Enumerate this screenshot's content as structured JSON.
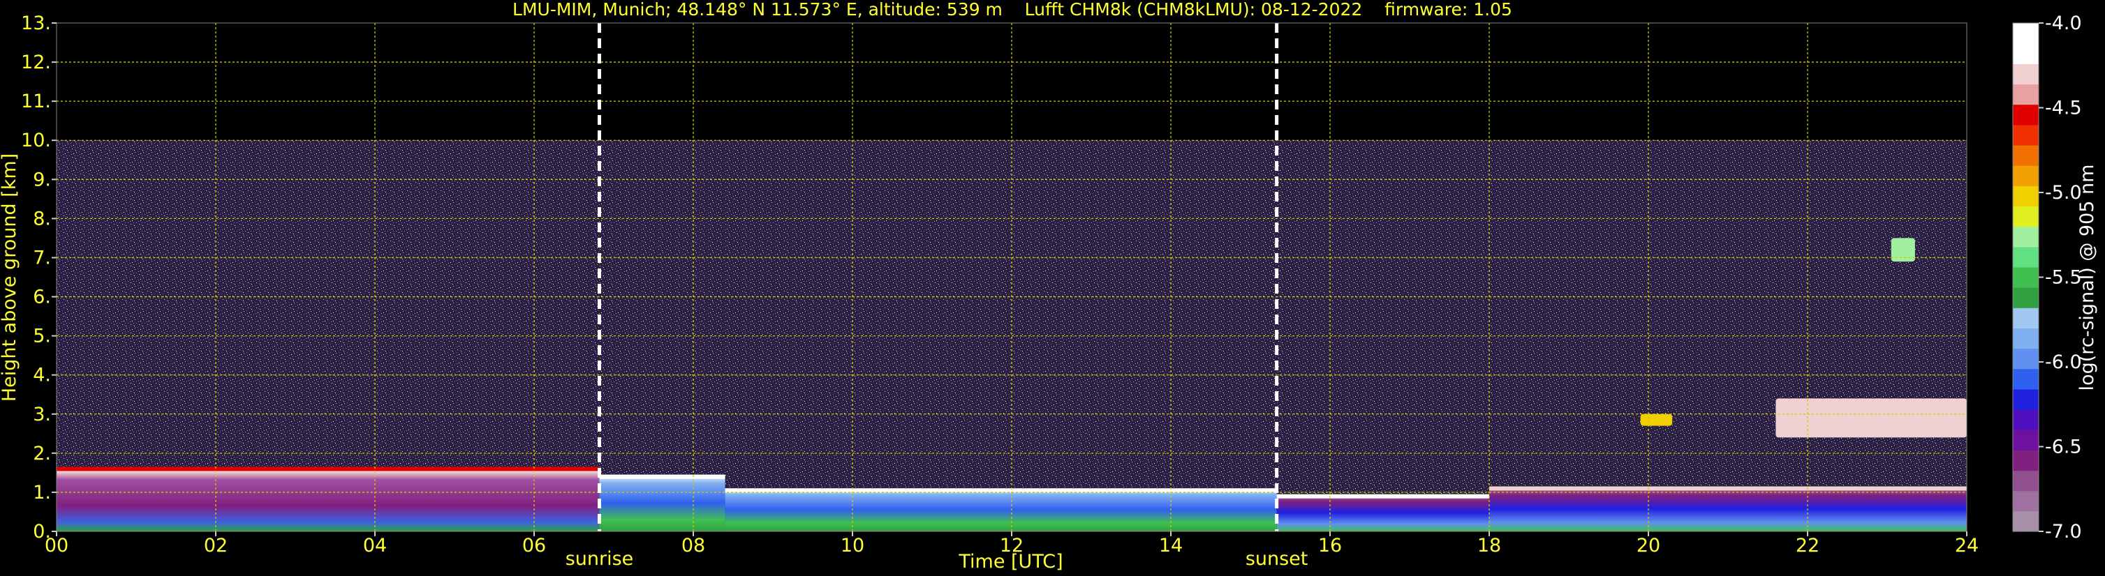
{
  "chart_data": {
    "type": "heatmap",
    "title": "LMU-MIM, Munich; 48.148° N 11.573° E, altitude: 539 m    Lufft CHM8k (CHM8kLMU): 08-12-2022    firmware: 1.05",
    "xlabel": "Time [UTC]",
    "ylabel": "Height above ground [km]",
    "xlim": [
      0,
      24
    ],
    "ylim": [
      0,
      13
    ],
    "x_ticks": [
      "00",
      "02",
      "04",
      "06",
      "08",
      "10",
      "12",
      "14",
      "16",
      "18",
      "20",
      "22",
      "24"
    ],
    "y_ticks": [
      "0.",
      "1.",
      "2.",
      "3.",
      "4.",
      "5.",
      "6.",
      "7.",
      "8.",
      "9.",
      "10.",
      "11.",
      "12.",
      "13."
    ],
    "grid": true,
    "grid_color": "#cccc00",
    "text_color": "#ffff33",
    "background": "#000000",
    "data_ceiling_km": 10.0,
    "events": [
      {
        "label": "sunrise",
        "time_h": 6.82
      },
      {
        "label": "sunset",
        "time_h": 15.33
      }
    ],
    "colorbar": {
      "label": "log(rc-signal) @ 905 nm",
      "range": [
        -7.0,
        -4.0
      ],
      "ticks": [
        "-4.0",
        "-4.5",
        "-5.0",
        "-5.5",
        "-6.0",
        "-6.5",
        "-7.0"
      ],
      "colors": [
        "#a890a8",
        "#a070a0",
        "#905090",
        "#802080",
        "#7010a0",
        "#5010c0",
        "#2020e0",
        "#3060f0",
        "#6090f0",
        "#80b0f0",
        "#a0c8f0",
        "#30a040",
        "#40c050",
        "#60e080",
        "#a0f0a0",
        "#e0f020",
        "#f0d000",
        "#f0a000",
        "#f07000",
        "#f03000",
        "#e00000",
        "#e8a0a0",
        "#f0d0d0",
        "#ffffff",
        "#ffffff"
      ]
    },
    "layers": [
      {
        "name_note": "",
        "t_start": 0.0,
        "t_end": 6.82,
        "bottom_km": 0.0,
        "top_km": 1.65,
        "value": -6.7
      },
      {
        "t_start": 6.82,
        "t_end": 8.4,
        "bottom_km": 0.0,
        "top_km": 1.45,
        "value": -6.2
      },
      {
        "t_start": 8.4,
        "t_end": 15.33,
        "bottom_km": 0.0,
        "top_km": 1.1,
        "value": -5.9
      },
      {
        "t_start": 15.33,
        "t_end": 18.0,
        "bottom_km": 0.0,
        "top_km": 0.95,
        "value": -6.1
      },
      {
        "t_start": 18.0,
        "t_end": 24.0,
        "bottom_km": 0.0,
        "top_km": 1.15,
        "value": -6.5
      }
    ],
    "cloud_features": [
      {
        "t_start": 19.9,
        "t_end": 20.3,
        "bottom_km": 2.7,
        "top_km": 3.0,
        "value": -5.0
      },
      {
        "t_start": 21.6,
        "t_end": 24.0,
        "bottom_km": 2.4,
        "top_km": 3.4,
        "value": -4.3
      },
      {
        "t_start": 23.05,
        "t_end": 23.35,
        "bottom_km": 6.9,
        "top_km": 7.5,
        "value": -5.2
      }
    ]
  }
}
